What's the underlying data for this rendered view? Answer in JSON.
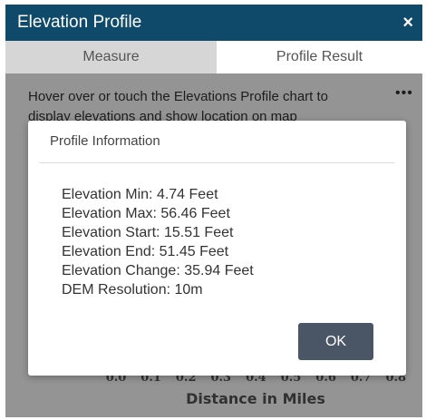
{
  "window": {
    "title": "Elevation Profile",
    "close_glyph": "×"
  },
  "tabs": [
    {
      "label": "Measure",
      "active": false
    },
    {
      "label": "Profile Result",
      "active": true
    }
  ],
  "hint": "Hover over or touch the Elevations Profile chart to display elevations and show location on map",
  "more_glyph": "•••",
  "chart_data": {
    "type": "line",
    "xlabel": "Distance in Miles",
    "x_ticks": [
      "0.0",
      "0.1",
      "0.2",
      "0.3",
      "0.4",
      "0.5",
      "0.6",
      "0.7",
      "0.8"
    ]
  },
  "dialog": {
    "title": "Profile Information",
    "rows": [
      "Elevation Min: 4.74 Feet",
      "Elevation Max: 56.46 Feet",
      "Elevation Start: 15.51 Feet",
      "Elevation End: 51.45 Feet",
      "Elevation Change: 35.94 Feet",
      "DEM Resolution: 10m"
    ],
    "ok_label": "OK"
  },
  "colors": {
    "header": "#0f4a6b",
    "button": "#4a5565"
  },
  "icons": {
    "close": "close-icon",
    "more": "more-options-icon"
  }
}
